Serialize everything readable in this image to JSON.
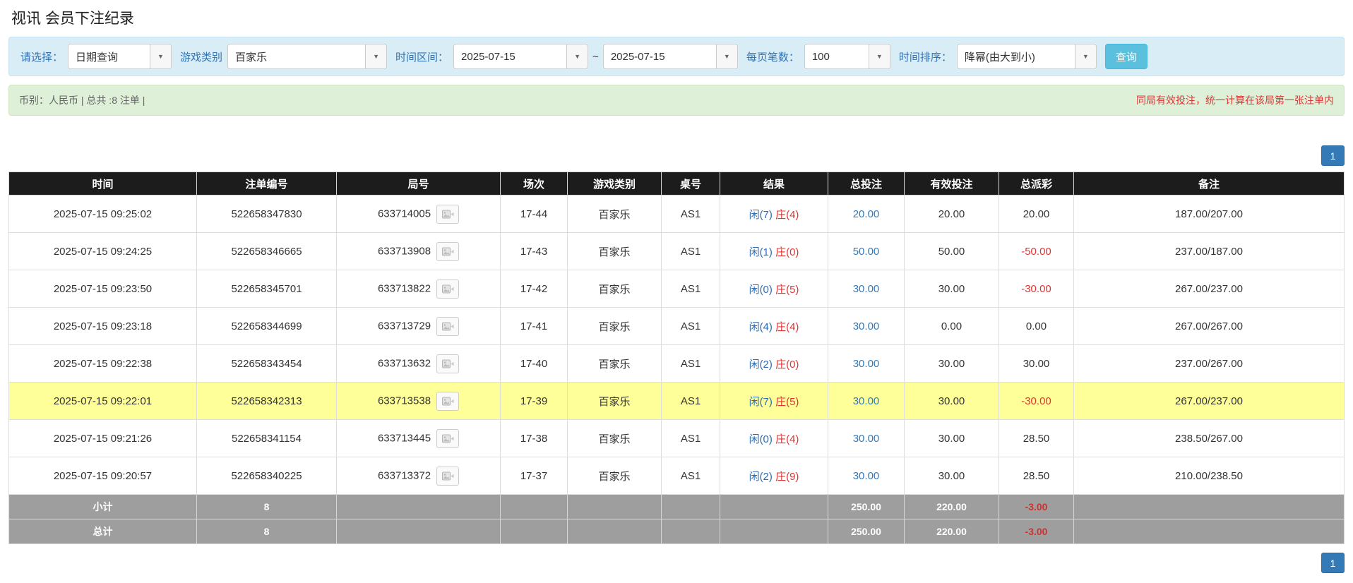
{
  "page_title": "视讯 会员下注纪录",
  "filters": {
    "select_label": "请选择：",
    "select_value": "日期查询",
    "game_type_label": "游戏类别",
    "game_type_value": "百家乐",
    "time_range_label": "时间区间：",
    "date_from": "2025-07-15",
    "tilde": "~",
    "date_to": "2025-07-15",
    "per_page_label": "每页笔数：",
    "per_page_value": "100",
    "sort_label": "时间排序：",
    "sort_value": "降幂(由大到小)",
    "search_button": "查询"
  },
  "info_bar": {
    "left": "币别：人民币 | 总共 :8 注单 |",
    "right": "同局有效投注，统一计算在该局第一张注单内"
  },
  "pagination": {
    "page": "1"
  },
  "colors": {
    "accent_blue": "#337ab7",
    "search_button_blue": "#5bc0de",
    "filter_bar_bg": "#d9edf7",
    "info_bar_bg": "#dff0d8",
    "highlight_row_yellow": "#ffff99",
    "header_bg": "#1c1c1c",
    "summary_row_bg": "#9e9e9e",
    "player_blue": "#2b6cb5",
    "banker_red": "#e03333",
    "negative_red": "#e03333"
  },
  "table": {
    "headers": [
      "时间",
      "注单编号",
      "局号",
      "场次",
      "游戏类别",
      "桌号",
      "结果",
      "总投注",
      "有效投注",
      "总派彩",
      "备注"
    ],
    "rows": [
      {
        "time": "2025-07-15 09:25:02",
        "bet_id": "522658347830",
        "round_id": "633714005",
        "session": "17-44",
        "game": "百家乐",
        "table_no": "AS1",
        "result_player": "闲(7)",
        "result_banker": "庄(4)",
        "total_bet": "20.00",
        "valid_bet": "20.00",
        "payout": "20.00",
        "remark": "187.00/207.00",
        "highlight": false
      },
      {
        "time": "2025-07-15 09:24:25",
        "bet_id": "522658346665",
        "round_id": "633713908",
        "session": "17-43",
        "game": "百家乐",
        "table_no": "AS1",
        "result_player": "闲(1)",
        "result_banker": "庄(0)",
        "total_bet": "50.00",
        "valid_bet": "50.00",
        "payout": "-50.00",
        "remark": "237.00/187.00",
        "highlight": false
      },
      {
        "time": "2025-07-15 09:23:50",
        "bet_id": "522658345701",
        "round_id": "633713822",
        "session": "17-42",
        "game": "百家乐",
        "table_no": "AS1",
        "result_player": "闲(0)",
        "result_banker": "庄(5)",
        "total_bet": "30.00",
        "valid_bet": "30.00",
        "payout": "-30.00",
        "remark": "267.00/237.00",
        "highlight": false
      },
      {
        "time": "2025-07-15 09:23:18",
        "bet_id": "522658344699",
        "round_id": "633713729",
        "session": "17-41",
        "game": "百家乐",
        "table_no": "AS1",
        "result_player": "闲(4)",
        "result_banker": "庄(4)",
        "total_bet": "30.00",
        "valid_bet": "0.00",
        "payout": "0.00",
        "remark": "267.00/267.00",
        "highlight": false
      },
      {
        "time": "2025-07-15 09:22:38",
        "bet_id": "522658343454",
        "round_id": "633713632",
        "session": "17-40",
        "game": "百家乐",
        "table_no": "AS1",
        "result_player": "闲(2)",
        "result_banker": "庄(0)",
        "total_bet": "30.00",
        "valid_bet": "30.00",
        "payout": "30.00",
        "remark": "237.00/267.00",
        "highlight": false
      },
      {
        "time": "2025-07-15 09:22:01",
        "bet_id": "522658342313",
        "round_id": "633713538",
        "session": "17-39",
        "game": "百家乐",
        "table_no": "AS1",
        "result_player": "闲(7)",
        "result_banker": "庄(5)",
        "total_bet": "30.00",
        "valid_bet": "30.00",
        "payout": "-30.00",
        "remark": "267.00/237.00",
        "highlight": true
      },
      {
        "time": "2025-07-15 09:21:26",
        "bet_id": "522658341154",
        "round_id": "633713445",
        "session": "17-38",
        "game": "百家乐",
        "table_no": "AS1",
        "result_player": "闲(0)",
        "result_banker": "庄(4)",
        "total_bet": "30.00",
        "valid_bet": "30.00",
        "payout": "28.50",
        "remark": "238.50/267.00",
        "highlight": false
      },
      {
        "time": "2025-07-15 09:20:57",
        "bet_id": "522658340225",
        "round_id": "633713372",
        "session": "17-37",
        "game": "百家乐",
        "table_no": "AS1",
        "result_player": "闲(2)",
        "result_banker": "庄(9)",
        "total_bet": "30.00",
        "valid_bet": "30.00",
        "payout": "28.50",
        "remark": "210.00/238.50",
        "highlight": false
      }
    ],
    "subtotal": {
      "label": "小计",
      "count": "8",
      "total_bet": "250.00",
      "valid_bet": "220.00",
      "payout": "-3.00"
    },
    "total": {
      "label": "总计",
      "count": "8",
      "total_bet": "250.00",
      "valid_bet": "220.00",
      "payout": "-3.00"
    }
  }
}
